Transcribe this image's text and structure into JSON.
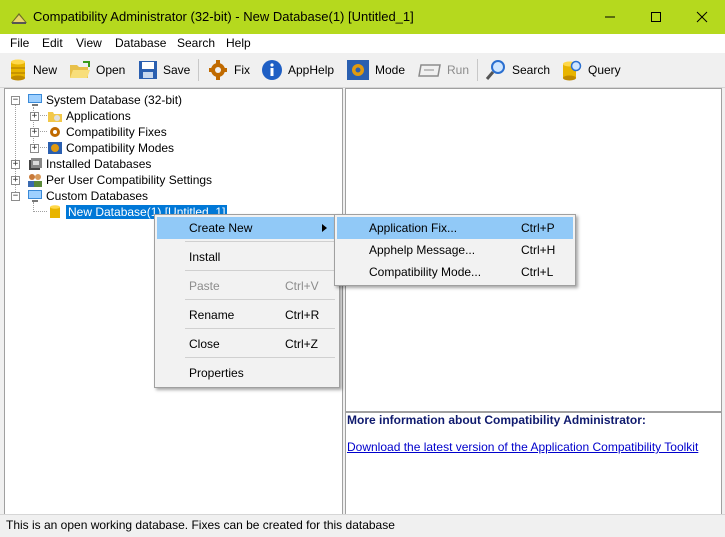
{
  "window": {
    "title": "Compatibility Administrator (32-bit) - New Database(1) [Untitled_1]",
    "title_bar_color": "#b5d91e"
  },
  "menu": [
    "File",
    "Edit",
    "View",
    "Database",
    "Search",
    "Help"
  ],
  "toolbar": {
    "new": "New",
    "open": "Open",
    "save": "Save",
    "fix": "Fix",
    "apphelp": "AppHelp",
    "mode": "Mode",
    "run": "Run",
    "search": "Search",
    "query": "Query"
  },
  "tree": {
    "system_db": "System Database (32-bit)",
    "applications": "Applications",
    "compat_fixes": "Compatibility Fixes",
    "compat_modes": "Compatibility Modes",
    "installed_db": "Installed Databases",
    "per_user": "Per User Compatibility Settings",
    "custom_db": "Custom Databases",
    "new_db": "New Database(1) [Untitled_1]"
  },
  "context_menu": {
    "create_new": "Create New",
    "install": "Install",
    "paste": "Paste",
    "paste_shortcut": "Ctrl+V",
    "rename": "Rename",
    "rename_shortcut": "Ctrl+R",
    "close": "Close",
    "close_shortcut": "Ctrl+Z",
    "properties": "Properties"
  },
  "submenu": {
    "app_fix": "Application Fix...",
    "app_fix_shortcut": "Ctrl+P",
    "apphelp_msg": "Apphelp Message...",
    "apphelp_msg_shortcut": "Ctrl+H",
    "compat_mode": "Compatibility Mode...",
    "compat_mode_shortcut": "Ctrl+L"
  },
  "info": {
    "heading": "More information about Compatibility Administrator:",
    "link": "Download the latest version of the Application Compatibility Toolkit"
  },
  "status": "This is an open working database. Fixes can be created for this database",
  "colors": {
    "selection": "#0078d7",
    "menu_highlight": "#91c9f7",
    "link": "#0000cc"
  }
}
